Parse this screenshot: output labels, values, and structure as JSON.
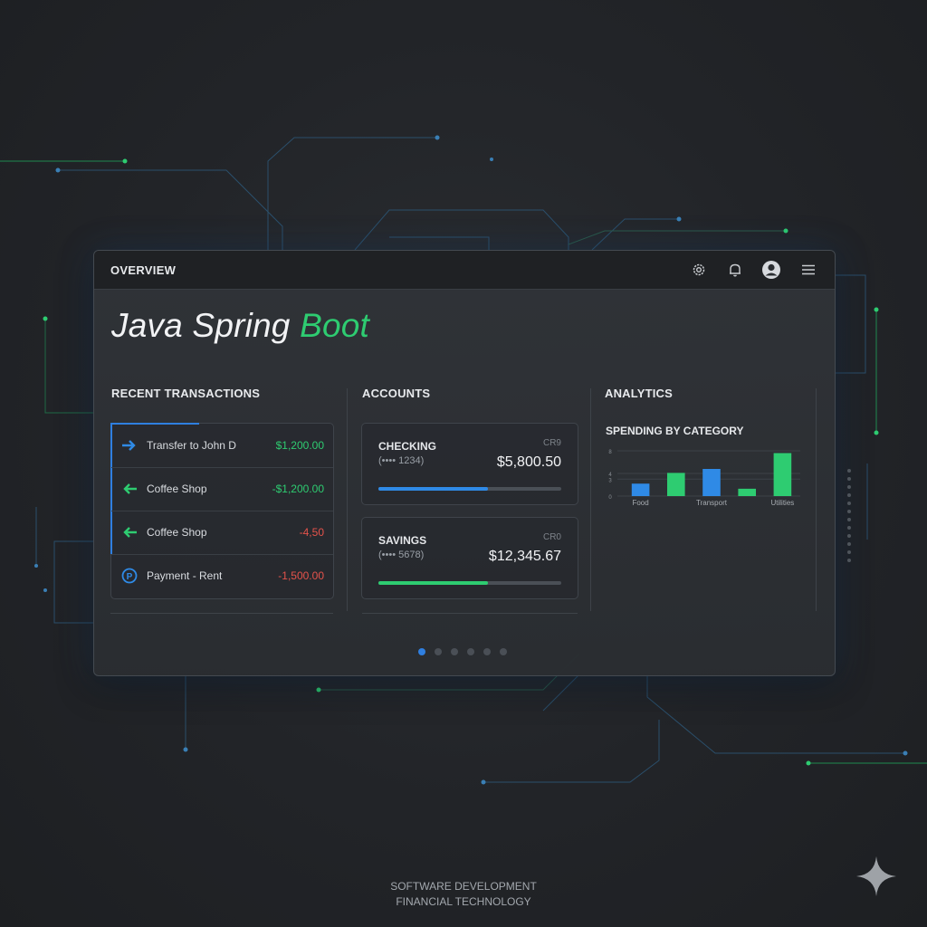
{
  "window": {
    "title": "OVERVIEW",
    "icons": [
      "gear-icon",
      "bell-icon",
      "user-avatar-icon",
      "menu-icon"
    ]
  },
  "hero": {
    "part1": "Java Spring ",
    "part2": "Boot"
  },
  "transactions": {
    "heading": "RECENT TRANSACTIONS",
    "items": [
      {
        "icon": "arrow-right-icon",
        "label": "Transfer to John D",
        "amount": "$1,200.00",
        "amount_color": "#2ecc71",
        "icon_color": "#2f8ae6"
      },
      {
        "icon": "arrow-left-icon",
        "label": "Coffee Shop",
        "amount": "-$1,200.00",
        "amount_color": "#2ecc71",
        "icon_color": "#2ecc71"
      },
      {
        "icon": "arrow-left-icon",
        "label": "Coffee Shop",
        "amount": "-4,50",
        "amount_color": "#e5534b",
        "icon_color": "#2ecc71"
      },
      {
        "icon": "parking-icon",
        "label": "Payment - Rent",
        "amount": "-1,500.00",
        "amount_color": "#e5534b",
        "icon_color": "#2f8ae6"
      }
    ]
  },
  "accounts": {
    "heading": "ACCOUNTS",
    "items": [
      {
        "name": "CHECKING",
        "number": "(•••• 1234)",
        "code": "CR9",
        "balance": "$5,800.50",
        "progress": 0.6,
        "bar_color": "#2f8ae6"
      },
      {
        "name": "SAVINGS",
        "number": "(•••• 5678)",
        "code": "CR0",
        "balance": "$12,345.67",
        "progress": 0.6,
        "bar_color": "#2ecc71"
      }
    ]
  },
  "analytics": {
    "heading": "ANALYTICS",
    "subheading": "SPENDING BY CATEGORY"
  },
  "chart_data": {
    "type": "bar",
    "title": "SPENDING BY CATEGORY",
    "y_ticks": [
      "0",
      "3",
      "4",
      "8"
    ],
    "x_tick_labels": [
      "Food",
      "Transport",
      "Utilities"
    ],
    "values": [
      2.2,
      4.1,
      4.8,
      1.3,
      7.6
    ],
    "colors": [
      "#2f8ae6",
      "#2ecc71",
      "#2f8ae6",
      "#2ecc71",
      "#2ecc71"
    ],
    "ylim": [
      0,
      8
    ],
    "grid": true
  },
  "pagination": {
    "count": 6,
    "active": 0
  },
  "colors": {
    "accent_green": "#2ecc71",
    "accent_blue": "#2f8ae6",
    "negative_red": "#e5534b"
  },
  "footer": {
    "line1": "SOFTWARE DEVELOPMENT",
    "line2": "FINANCIAL TECHNOLOGY"
  }
}
